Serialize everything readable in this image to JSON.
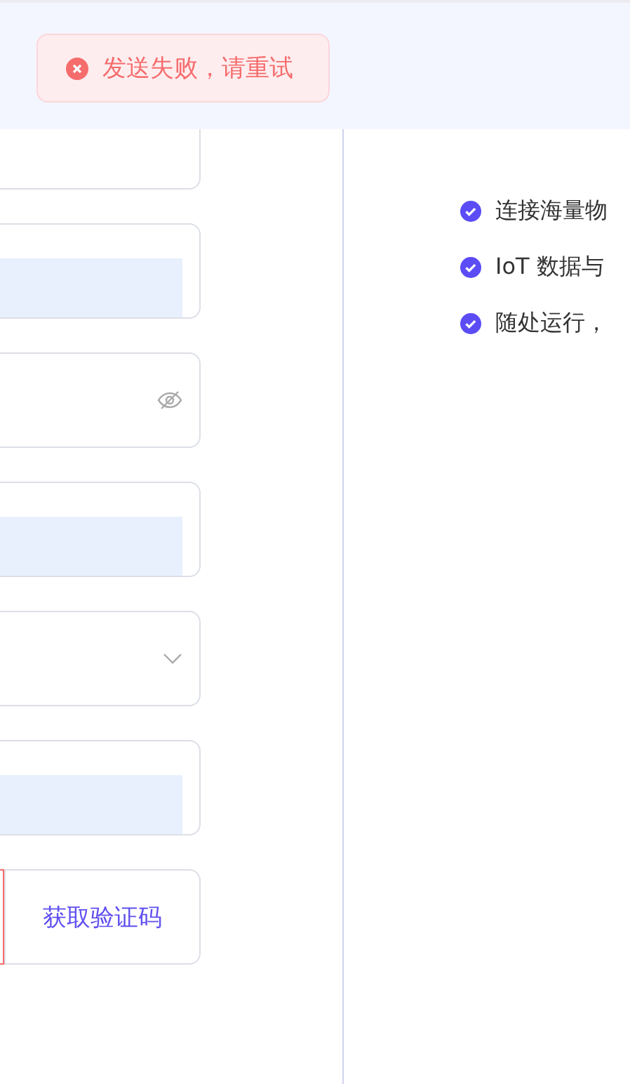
{
  "toast": {
    "kind": "error",
    "message": "发送失败，请重试"
  },
  "form": {
    "fields": [
      {
        "kind": "text"
      },
      {
        "kind": "autofilled"
      },
      {
        "kind": "password",
        "masked": true
      },
      {
        "kind": "autofilled"
      },
      {
        "kind": "select"
      },
      {
        "kind": "autofilled"
      },
      {
        "kind": "code",
        "invalid": true
      }
    ],
    "code_button": "获取验证码"
  },
  "promo": {
    "features": [
      "连接海量物",
      "IoT 数据与",
      "随处运行，"
    ]
  }
}
